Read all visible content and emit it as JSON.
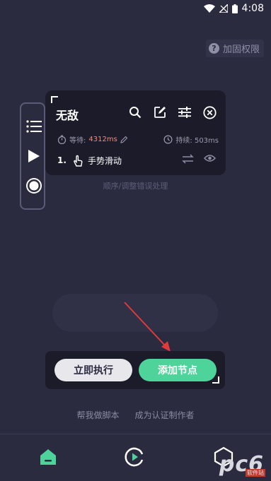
{
  "status": {
    "time": "4:08"
  },
  "permission": {
    "label": "加固权限",
    "icon": "help-icon"
  },
  "side_rail": {
    "items": [
      "list-icon",
      "play-icon",
      "record-icon"
    ]
  },
  "panel": {
    "title": "无敌",
    "tools": [
      "search-icon",
      "edit-icon",
      "settings-sliders-icon",
      "close-circle-icon"
    ],
    "wait_label": "等待:",
    "wait_value": "4312ms",
    "duration_label": "持续: 503ms",
    "step_number": "1.",
    "step_label": "手势滑动"
  },
  "hint": "顺序/调整错误处理",
  "actions": {
    "run_label": "立即执行",
    "add_label": "添加节点"
  },
  "links": {
    "help": "帮我做脚本",
    "become": "成为认证制作者"
  },
  "watermark": {
    "text": "pc6",
    "sub": "软件站"
  },
  "colors": {
    "accent": "#4ed49a",
    "background": "#2b2b40",
    "panel": "#1b1b2a",
    "wait_value": "#f28b7b"
  }
}
